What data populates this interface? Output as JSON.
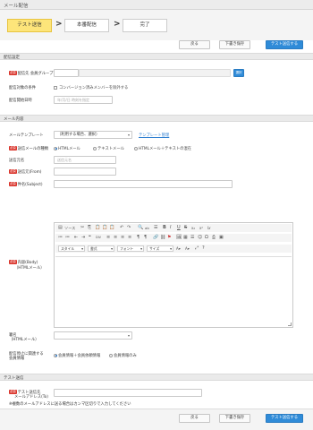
{
  "app": {
    "title": "メール配信"
  },
  "steps": [
    {
      "label": "テスト送信"
    },
    {
      "label": "本番配信"
    },
    {
      "label": "完了"
    }
  ],
  "step_arrow": ">",
  "toolbar": {
    "back": "戻る",
    "draft": "下書き保存",
    "send_test": "テスト送信する"
  },
  "delivery_settings": {
    "heading": "配信設定",
    "required_badge": "必須",
    "group_label": "配信先 会員グループ",
    "group_value": "",
    "select_button": "選択",
    "condition_label": "配信対象の条件",
    "condition_checkbox": "コンバージョン済みメンバーを除外する",
    "schedule_label": "配信開始日時",
    "schedule_placeholder": "年/月/日 時刻を指定"
  },
  "mail_content": {
    "heading": "メール内容",
    "template_label": "メールテンプレート",
    "template_value": "（利用する場合、選択）",
    "template_link": "テンプレート管理",
    "format_label": "送信メールの種類",
    "format_options": [
      "HTMLメール",
      "テキストメール",
      "HTMLメール＋テキストの混在"
    ],
    "format_selected": 0,
    "sender_name_label": "送信元名",
    "sender_name_placeholder": "送信元名",
    "sender_label": "送信元(From)",
    "subject_label": "件名(Subject)",
    "body_label_1": "内容(Body)",
    "body_label_2": "（HTMLメール）",
    "editor": {
      "source_label": "ソース",
      "style_label": "スタイル",
      "format_label": "書式",
      "font_label": "フォント",
      "size_label": "サイズ",
      "row1_icons": [
        "✂",
        "⎘",
        "📋",
        "📋",
        "📋",
        "↶",
        "↷",
        "🔍",
        "ab",
        "☰",
        "B",
        "I",
        "U",
        "S",
        "x₂",
        "x²",
        "Ix"
      ],
      "row2_icons": [
        "≔",
        "≔",
        "⇤",
        "⇥",
        "❝",
        "DIV",
        "≡",
        "≡",
        "≡",
        "≡",
        "¶",
        "¶",
        "🔗",
        "⛓",
        "⚑",
        "🖼",
        "▦",
        "☰",
        "☺",
        "Ω",
        "⎙",
        "▣"
      ],
      "row3_icons": [
        "A▾",
        "A▾",
        "⤢",
        "?"
      ]
    },
    "signature_label_1": "署名",
    "signature_label_2": "（HTMLメール）",
    "unsubscribe_label_1": "配信停止に関連する",
    "unsubscribe_label_2": "会員情報",
    "unsubscribe_options": [
      "会員情報＋会員依頼情報",
      "会員情報のみ"
    ],
    "unsubscribe_selected": 0
  },
  "test_send": {
    "heading": "テスト送信",
    "address_label_1": "テスト送信先",
    "address_label_2": "メールアドレス(To)",
    "note": "※複数のメールアドレスに送る場合はカンマ区切りで入力してください"
  }
}
